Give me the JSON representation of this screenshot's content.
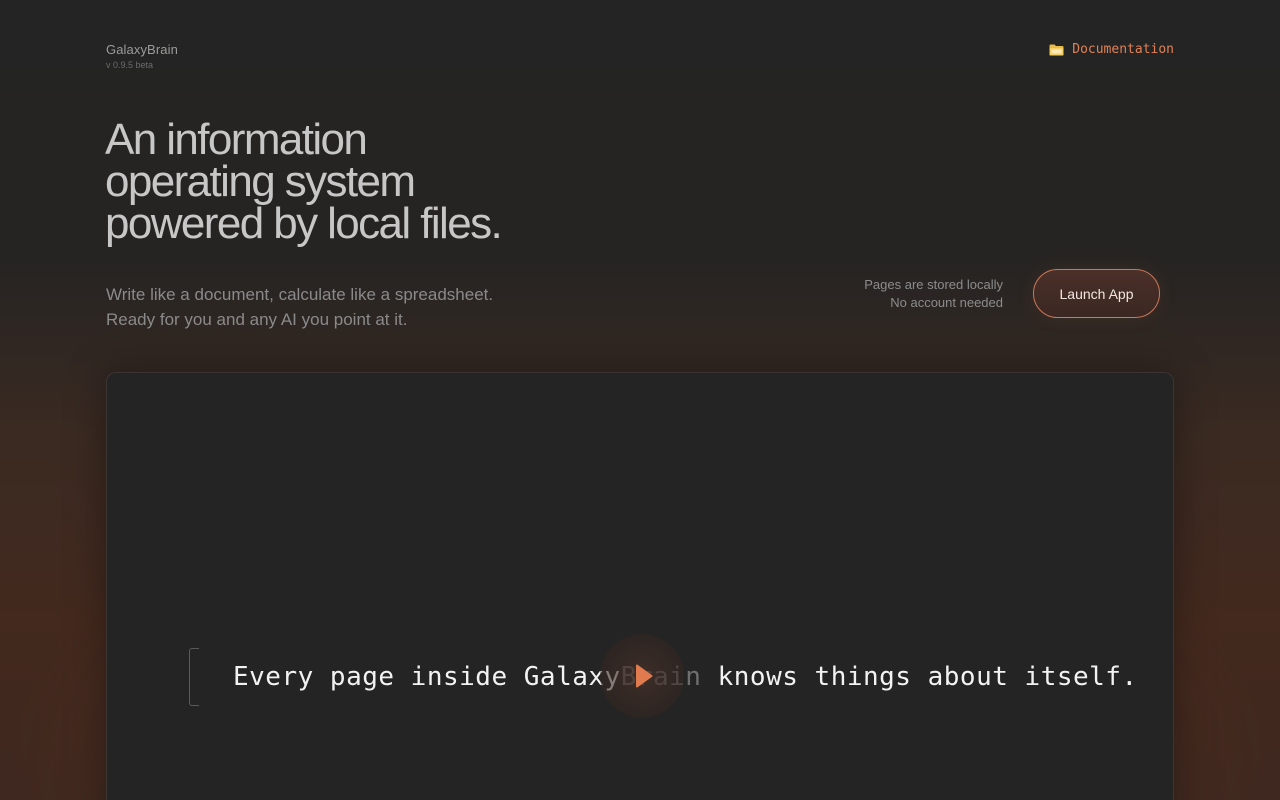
{
  "brand": {
    "name": "GalaxyBrain",
    "version": "v 0.9.5 beta"
  },
  "nav": {
    "docs_icon": "folder-icon",
    "docs_label": "Documentation",
    "accent_color": "#e08158"
  },
  "hero": {
    "headline_lines": [
      "An information",
      "operating system",
      "powered by local files."
    ],
    "subtitle_lines": [
      "Write like a document, calculate like a spreadsheet.",
      "Ready for you and any AI you point at it."
    ],
    "meta_lines": [
      "Pages are stored locally",
      "No account needed"
    ],
    "launch_label": "Launch App"
  },
  "video": {
    "caption_before": "Every page inside Galaxy",
    "caption_dim": "Brain",
    "caption_after": " knows things about itself.",
    "play_icon": "play-icon"
  }
}
